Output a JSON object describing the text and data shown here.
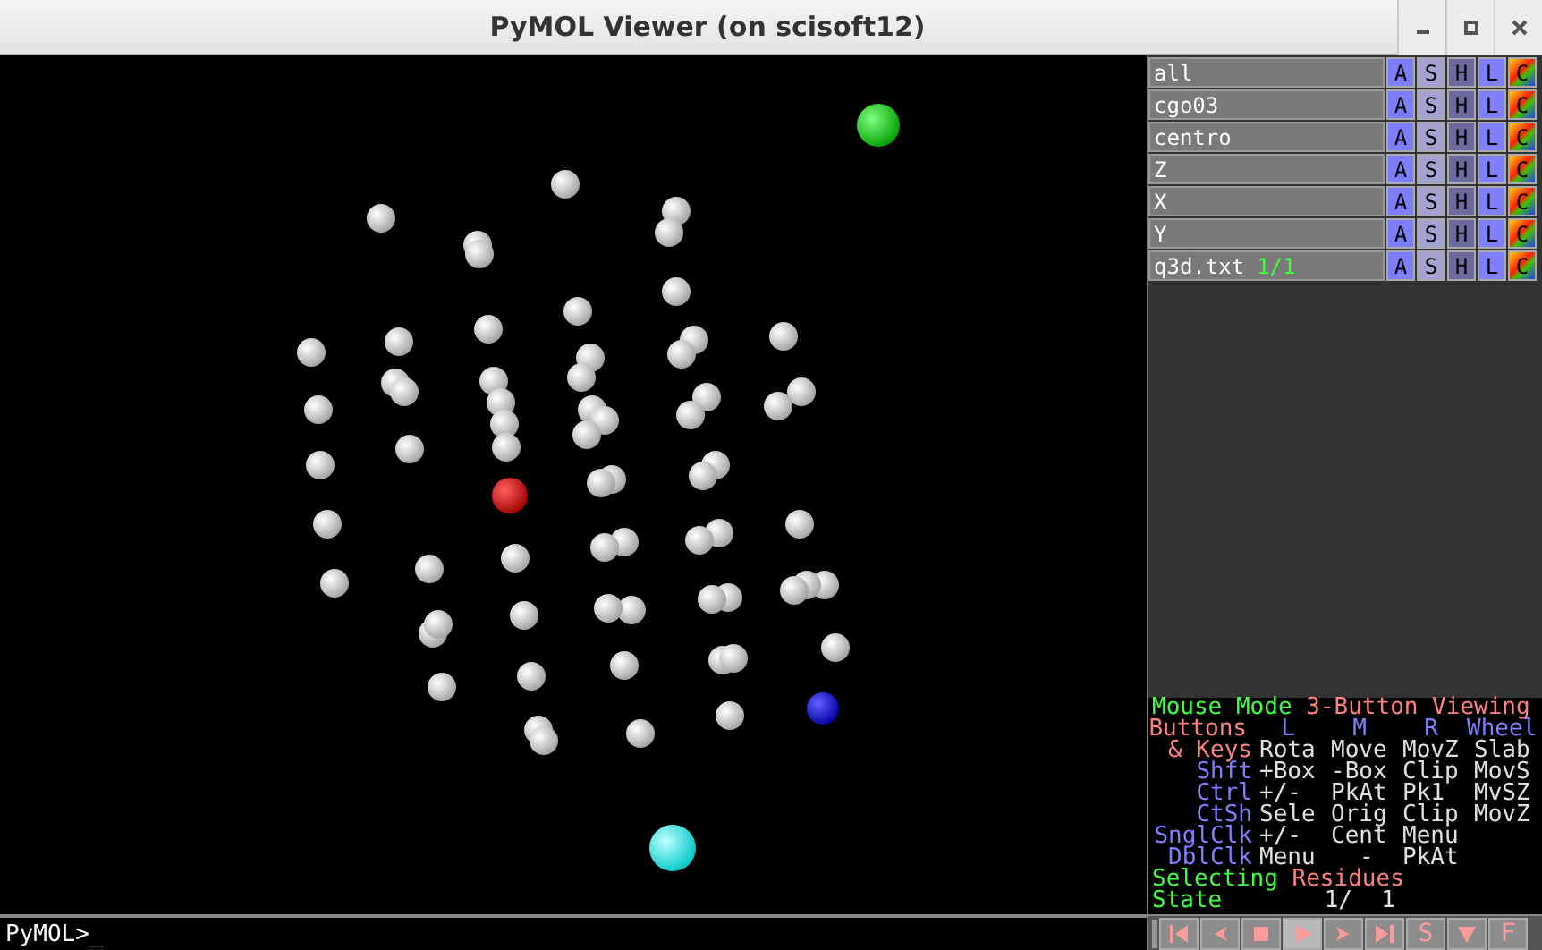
{
  "window": {
    "title": "PyMOL Viewer (on scisoft12)"
  },
  "objects": [
    {
      "name": "all",
      "buttons": [
        "A",
        "S",
        "H",
        "L",
        "C"
      ]
    },
    {
      "name": "cgo03",
      "buttons": [
        "A",
        "S",
        "H",
        "L",
        "C"
      ]
    },
    {
      "name": "centro",
      "buttons": [
        "A",
        "S",
        "H",
        "L",
        "C"
      ]
    },
    {
      "name": "Z",
      "buttons": [
        "A",
        "S",
        "H",
        "L",
        "C"
      ]
    },
    {
      "name": "X",
      "buttons": [
        "A",
        "S",
        "H",
        "L",
        "C"
      ]
    },
    {
      "name": "Y",
      "buttons": [
        "A",
        "S",
        "H",
        "L",
        "C"
      ]
    },
    {
      "name": "q3d.txt",
      "state": "1/1",
      "buttons": [
        "A",
        "S",
        "H",
        "L",
        "C"
      ]
    }
  ],
  "mouse": {
    "label": "Mouse Mode",
    "mode": "3-Button Viewing",
    "header": [
      {
        "text": "Buttons",
        "color": "#ff8080"
      },
      {
        "text": "L",
        "color": "#8080ff"
      },
      {
        "text": "M",
        "color": "#8080ff"
      },
      {
        "text": "R",
        "color": "#8080ff"
      },
      {
        "text": "Wheel",
        "color": "#8080ff"
      }
    ],
    "rows": [
      {
        "key": "& Keys",
        "color": "#ff8080",
        "actions": [
          "Rota",
          "Move",
          "MovZ",
          "Slab"
        ]
      },
      {
        "key": "Shft",
        "color": "#8080ff",
        "actions": [
          "+Box",
          "-Box",
          "Clip",
          "MovS"
        ]
      },
      {
        "key": "Ctrl",
        "color": "#8080ff",
        "actions": [
          "+/-",
          "PkAt",
          "Pk1",
          "MvSZ"
        ]
      },
      {
        "key": "CtSh",
        "color": "#8080ff",
        "actions": [
          "Sele",
          "Orig",
          "Clip",
          "MovZ"
        ]
      },
      {
        "key": "SnglClk",
        "color": "#8080ff",
        "actions": [
          "+/-",
          "Cent",
          "Menu"
        ]
      },
      {
        "key": "DblClk",
        "color": "#8080ff",
        "actions": [
          "Menu",
          "-",
          "PkAt"
        ]
      }
    ],
    "selecting_label": "Selecting",
    "selecting": "Residues",
    "state_label": "State",
    "state": "1/",
    "state_count": "1"
  },
  "player": [
    {
      "kind": "first",
      "selected": false
    },
    {
      "kind": "prev",
      "selected": false
    },
    {
      "kind": "stop",
      "selected": false
    },
    {
      "kind": "play",
      "selected": true
    },
    {
      "kind": "next",
      "selected": false
    },
    {
      "kind": "last",
      "selected": false
    },
    {
      "kind": "text",
      "label": "S",
      "selected": false
    },
    {
      "kind": "menu",
      "selected": false
    },
    {
      "kind": "text",
      "label": "F",
      "selected": false
    }
  ],
  "command": {
    "prompt": "PyMOL>_"
  }
}
